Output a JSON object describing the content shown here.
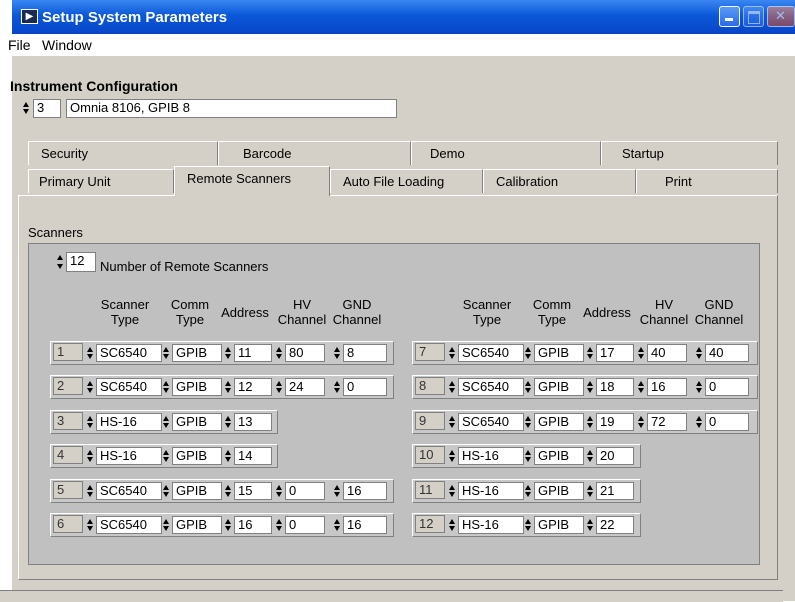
{
  "window": {
    "title": "Setup System Parameters"
  },
  "menu": {
    "file": "File",
    "window": "Window"
  },
  "instrument": {
    "label": "Instrument Configuration",
    "index": "3",
    "name": "Omnia 8106, GPIB 8"
  },
  "tabs_back": [
    "Security",
    "Barcode",
    "Demo",
    "Startup"
  ],
  "tabs_front": [
    "Primary Unit",
    "Remote Scanners",
    "Auto File Loading",
    "Calibration",
    "Print"
  ],
  "active_tab": "Remote Scanners",
  "scanners": {
    "label": "Scanners",
    "count": "12",
    "count_label": "Number of Remote Scanners",
    "headers": {
      "scanner_type": "Scanner Type",
      "comm_type": "Comm Type",
      "address": "Address",
      "hv_channel": "HV Channel",
      "gnd_channel": "GND Channel"
    },
    "rows": [
      {
        "num": "1",
        "type": "SC6540",
        "comm": "GPIB",
        "address": "11",
        "hv": "80",
        "gnd": "8"
      },
      {
        "num": "2",
        "type": "SC6540",
        "comm": "GPIB",
        "address": "12",
        "hv": "24",
        "gnd": "0"
      },
      {
        "num": "3",
        "type": "HS-16",
        "comm": "GPIB",
        "address": "13",
        "hv": "",
        "gnd": ""
      },
      {
        "num": "4",
        "type": "HS-16",
        "comm": "GPIB",
        "address": "14",
        "hv": "",
        "gnd": ""
      },
      {
        "num": "5",
        "type": "SC6540",
        "comm": "GPIB",
        "address": "15",
        "hv": "0",
        "gnd": "16"
      },
      {
        "num": "6",
        "type": "SC6540",
        "comm": "GPIB",
        "address": "16",
        "hv": "0",
        "gnd": "16"
      },
      {
        "num": "7",
        "type": "SC6540",
        "comm": "GPIB",
        "address": "17",
        "hv": "40",
        "gnd": "40"
      },
      {
        "num": "8",
        "type": "SC6540",
        "comm": "GPIB",
        "address": "18",
        "hv": "16",
        "gnd": "0"
      },
      {
        "num": "9",
        "type": "SC6540",
        "comm": "GPIB",
        "address": "19",
        "hv": "72",
        "gnd": "0"
      },
      {
        "num": "10",
        "type": "HS-16",
        "comm": "GPIB",
        "address": "20",
        "hv": "",
        "gnd": ""
      },
      {
        "num": "11",
        "type": "HS-16",
        "comm": "GPIB",
        "address": "21",
        "hv": "",
        "gnd": ""
      },
      {
        "num": "12",
        "type": "HS-16",
        "comm": "GPIB",
        "address": "22",
        "hv": "",
        "gnd": ""
      }
    ]
  },
  "colors": {
    "titlebar": "#0a58d8",
    "window_bg": "#d4d0c8",
    "scanner_panel": "#c0c0c0"
  },
  "icons": {
    "app": "labview-app-icon",
    "minimize": "minimize-icon",
    "maximize": "maximize-icon",
    "close": "close-icon",
    "spinner": "spinner-arrows-icon"
  }
}
